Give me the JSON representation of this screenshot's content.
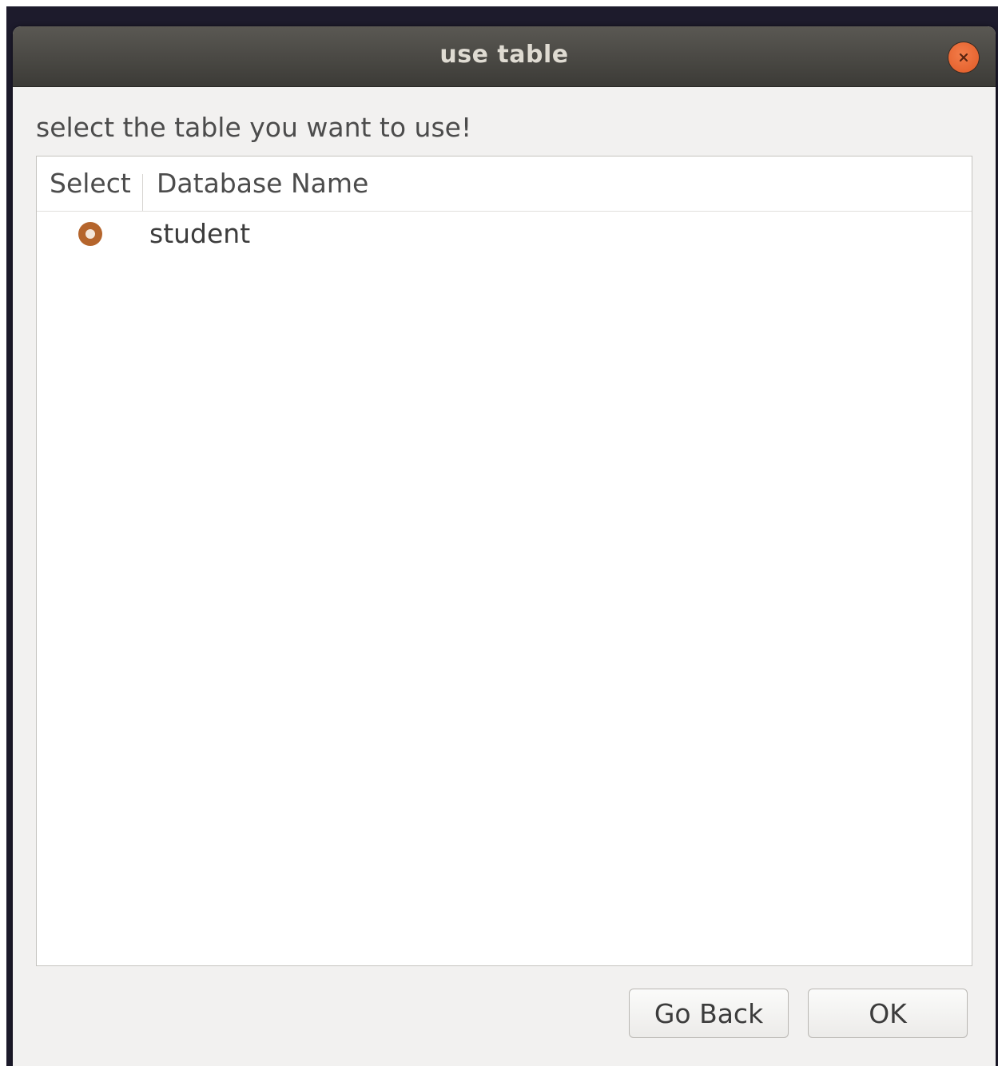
{
  "window": {
    "title": "use table"
  },
  "dialog": {
    "prompt": "select  the table  you want to use!"
  },
  "table": {
    "columns": [
      "Select",
      "Database Name"
    ],
    "rows": [
      {
        "selected": true,
        "name": "student"
      }
    ]
  },
  "buttons": {
    "go_back": "Go Back",
    "ok": "OK"
  },
  "colors": {
    "accent": "#b5652c",
    "close_button": "#e8622e",
    "titlebar": "#3c3b37"
  },
  "icons": {
    "close": "close-icon"
  }
}
